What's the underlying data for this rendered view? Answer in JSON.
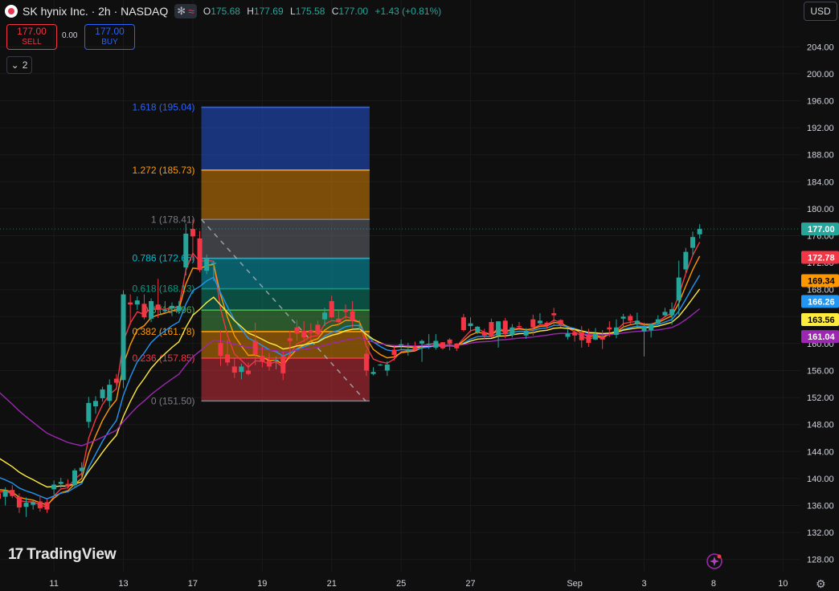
{
  "header": {
    "symbol": "SK hynix Inc. · 2h · NASDAQ",
    "open_label": "O",
    "open": "175.68",
    "high_label": "H",
    "high": "177.69",
    "low_label": "L",
    "low": "175.58",
    "close_label": "C",
    "close": "177.00",
    "change": "+1.43 (+0.81%)"
  },
  "trade": {
    "sell_price": "177.00",
    "sell_label": "SELL",
    "spread": "0.00",
    "buy_price": "177.00",
    "buy_label": "BUY"
  },
  "indicators_collapsed_count": "2",
  "currency": "USD",
  "brand": "TradingView",
  "colors": {
    "background": "#0f0f0f",
    "up": "#26a69a",
    "down": "#f23645",
    "grid": "#1c1c1c"
  },
  "chart_data": {
    "type": "candlestick",
    "y_axis": {
      "min": 126,
      "max": 206,
      "ticks": [
        128,
        132,
        136,
        140,
        144,
        148,
        152,
        156,
        160,
        164,
        168,
        172,
        176,
        180,
        184,
        188,
        192,
        196,
        200,
        204
      ]
    },
    "x_ticks": [
      {
        "i": 8,
        "label": "11"
      },
      {
        "i": 18,
        "label": "13"
      },
      {
        "i": 28,
        "label": "17"
      },
      {
        "i": 38,
        "label": "19"
      },
      {
        "i": 48,
        "label": "21"
      },
      {
        "i": 58,
        "label": "25"
      },
      {
        "i": 68,
        "label": "27"
      },
      {
        "i": 83,
        "label": "Sep"
      },
      {
        "i": 93,
        "label": "3"
      },
      {
        "i": 103,
        "label": "8"
      },
      {
        "i": 113,
        "label": "10"
      }
    ],
    "candles": [
      [
        137.8,
        138.7,
        135.7,
        137.0
      ],
      [
        137.3,
        138.7,
        136.0,
        138.2
      ],
      [
        138.3,
        139.0,
        137.1,
        137.4
      ],
      [
        137.3,
        137.8,
        134.9,
        135.7
      ],
      [
        135.8,
        137.2,
        134.3,
        136.4
      ],
      [
        136.1,
        136.9,
        135.4,
        136.5
      ],
      [
        136.6,
        137.5,
        135.1,
        135.6
      ],
      [
        136.5,
        137.0,
        134.9,
        135.4
      ],
      [
        138.4,
        139.7,
        137.6,
        139.1
      ],
      [
        139.2,
        140.1,
        138.6,
        139.5
      ],
      [
        139.2,
        139.9,
        138.5,
        138.8
      ],
      [
        139.0,
        141.5,
        138.6,
        141.2
      ],
      [
        141.1,
        142.4,
        140.1,
        141.6
      ],
      [
        148.4,
        152.1,
        147.5,
        151.2
      ],
      [
        150.7,
        152.2,
        149.6,
        151.5
      ],
      [
        151.9,
        153.6,
        151.4,
        153.2
      ],
      [
        151.5,
        154.7,
        150.6,
        153.9
      ],
      [
        154.8,
        155.5,
        153.8,
        154.2
      ],
      [
        154.6,
        167.9,
        153.4,
        167.3
      ],
      [
        166.1,
        167.3,
        162.8,
        165.8
      ],
      [
        165.8,
        167.0,
        165.0,
        166.4
      ],
      [
        165.9,
        167.3,
        163.6,
        163.9
      ],
      [
        163.7,
        166.7,
        163.2,
        166.3
      ],
      [
        165.8,
        169.6,
        163.8,
        165.0
      ],
      [
        164.8,
        166.3,
        164.5,
        165.0
      ],
      [
        165.2,
        166.1,
        164.1,
        165.6
      ],
      [
        164.8,
        166.3,
        164.4,
        165.6
      ],
      [
        171.3,
        177.8,
        170.1,
        176.3
      ],
      [
        177.0,
        178.4,
        172.3,
        175.9
      ],
      [
        175.6,
        176.7,
        170.6,
        170.9
      ],
      [
        170.8,
        173.2,
        170.3,
        172.6
      ],
      [
        171.8,
        172.3,
        169.3,
        172.0
      ],
      [
        160.1,
        162.0,
        156.7,
        158.2
      ],
      [
        158.4,
        160.6,
        156.7,
        157.2
      ],
      [
        156.6,
        157.9,
        154.9,
        155.7
      ],
      [
        155.8,
        157.0,
        154.7,
        156.6
      ],
      [
        156.0,
        157.2,
        155.3,
        155.5
      ],
      [
        160.4,
        163.1,
        156.8,
        158.4
      ],
      [
        158.2,
        159.6,
        156.5,
        157.3
      ],
      [
        157.5,
        158.6,
        156.0,
        156.6
      ],
      [
        157.6,
        158.1,
        156.2,
        157.6
      ],
      [
        158.1,
        158.8,
        154.6,
        155.6
      ],
      [
        160.8,
        161.9,
        157.7,
        160.4
      ],
      [
        162.4,
        163.5,
        160.4,
        161.5
      ],
      [
        161.9,
        163.3,
        160.2,
        160.9
      ],
      [
        162.0,
        163.0,
        160.5,
        161.6
      ],
      [
        162.8,
        163.4,
        161.2,
        161.4
      ],
      [
        163.6,
        165.3,
        162.6,
        164.6
      ],
      [
        166.3,
        167.1,
        163.8,
        163.9
      ],
      [
        163.7,
        165.1,
        162.7,
        163.2
      ],
      [
        165.1,
        165.8,
        163.7,
        164.7
      ],
      [
        164.8,
        166.3,
        162.3,
        163.4
      ],
      [
        162.7,
        163.5,
        162.0,
        162.7
      ],
      [
        158.5,
        159.1,
        155.2,
        156.0
      ],
      [
        155.5,
        156.5,
        155.3,
        155.8
      ],
      [
        156.8,
        157.0,
        156.7,
        156.9
      ],
      [
        156.0,
        157.4,
        155.2,
        156.9
      ],
      [
        159.1,
        159.7,
        157.5,
        158.3
      ],
      [
        159.7,
        160.6,
        159.2,
        159.9
      ],
      [
        158.9,
        160.1,
        158.2,
        159.1
      ],
      [
        159.5,
        160.3,
        158.8,
        159.1
      ],
      [
        160.0,
        160.6,
        157.3,
        160.4
      ],
      [
        159.9,
        161.4,
        159.2,
        160.0
      ],
      [
        159.4,
        161.4,
        159.1,
        160.4
      ],
      [
        160.2,
        160.2,
        159.1,
        159.3
      ],
      [
        160.6,
        160.8,
        159.0,
        160.0
      ],
      [
        160.0,
        160.1,
        158.9,
        159.3
      ],
      [
        163.9,
        164.4,
        161.8,
        162.0
      ],
      [
        162.6,
        163.9,
        161.7,
        163.0
      ],
      [
        161.7,
        162.6,
        161.4,
        162.5
      ],
      [
        161.7,
        162.2,
        160.7,
        161.2
      ],
      [
        163.2,
        163.7,
        160.9,
        161.0
      ],
      [
        161.2,
        163.3,
        159.4,
        163.3
      ],
      [
        163.4,
        163.8,
        160.8,
        161.4
      ],
      [
        161.3,
        162.9,
        160.9,
        162.4
      ],
      [
        162.6,
        163.2,
        162.2,
        162.5
      ],
      [
        161.2,
        162.3,
        160.7,
        161.8
      ],
      [
        163.6,
        164.3,
        161.2,
        162.4
      ],
      [
        163.0,
        164.5,
        162.9,
        163.4
      ],
      [
        163.1,
        163.3,
        162.2,
        162.7
      ],
      [
        164.5,
        165.3,
        162.6,
        164.2
      ],
      [
        163.5,
        163.6,
        162.4,
        162.8
      ],
      [
        161.0,
        162.1,
        160.6,
        161.5
      ],
      [
        161.7,
        162.1,
        160.3,
        161.2
      ],
      [
        161.7,
        162.6,
        159.4,
        160.5
      ],
      [
        161.3,
        162.2,
        159.5,
        160.1
      ],
      [
        160.6,
        162.3,
        160.5,
        161.4
      ],
      [
        161.0,
        162.0,
        159.2,
        160.6
      ],
      [
        162.4,
        163.3,
        161.0,
        162.1
      ],
      [
        161.3,
        163.6,
        160.8,
        162.4
      ],
      [
        163.7,
        164.4,
        162.6,
        164.0
      ],
      [
        164.1,
        164.4,
        162.8,
        163.4
      ],
      [
        163.0,
        164.6,
        162.4,
        163.4
      ],
      [
        161.8,
        163.1,
        158.1,
        162.5
      ],
      [
        162.0,
        163.0,
        160.9,
        162.9
      ],
      [
        163.0,
        164.2,
        162.8,
        163.6
      ],
      [
        164.2,
        165.3,
        163.9,
        164.7
      ],
      [
        164.2,
        166.1,
        162.8,
        165.1
      ],
      [
        166.4,
        172.3,
        164.3,
        169.8
      ],
      [
        171.0,
        174.2,
        170.5,
        173.6
      ],
      [
        174.2,
        176.6,
        173.2,
        175.8
      ],
      [
        176.2,
        177.7,
        175.6,
        177.0
      ]
    ],
    "moving_averages": [
      {
        "color": "#f23645",
        "last": "172.78"
      },
      {
        "color": "#ff9800",
        "last": "169.34"
      },
      {
        "color": "#2196f3",
        "last": "166.26"
      },
      {
        "color": "#ffeb3b",
        "last": "163.56"
      },
      {
        "color": "#9c27b0",
        "last": "161.04"
      }
    ],
    "last_price": "177.00",
    "fibonacci": {
      "from_index": 29,
      "to_index": 53,
      "low": 151.5,
      "high": 178.41,
      "levels": [
        {
          "ratio": 0,
          "price": 151.5,
          "label": "0 (151.50)",
          "color": "#787b86"
        },
        {
          "ratio": 0.236,
          "price": 157.85,
          "label": "0.236 (157.85)",
          "color": "#f23645"
        },
        {
          "ratio": 0.382,
          "price": 161.78,
          "label": "0.382 (161.78)",
          "color": "#ff9800"
        },
        {
          "ratio": 0.5,
          "price": 164.96,
          "label": "0.5 (164.96)",
          "color": "#4caf50"
        },
        {
          "ratio": 0.618,
          "price": 168.13,
          "label": "0.618 (168.13)",
          "color": "#089981"
        },
        {
          "ratio": 0.786,
          "price": 172.65,
          "label": "0.786 (172.65)",
          "color": "#00bcd4"
        },
        {
          "ratio": 1,
          "price": 178.41,
          "label": "1 (178.41)",
          "color": "#787b86"
        },
        {
          "ratio": 1.272,
          "price": 185.73,
          "label": "1.272 (185.73)",
          "color": "#ff9800"
        },
        {
          "ratio": 1.618,
          "price": 195.04,
          "label": "1.618 (195.04)",
          "color": "#2962ff"
        }
      ]
    }
  }
}
